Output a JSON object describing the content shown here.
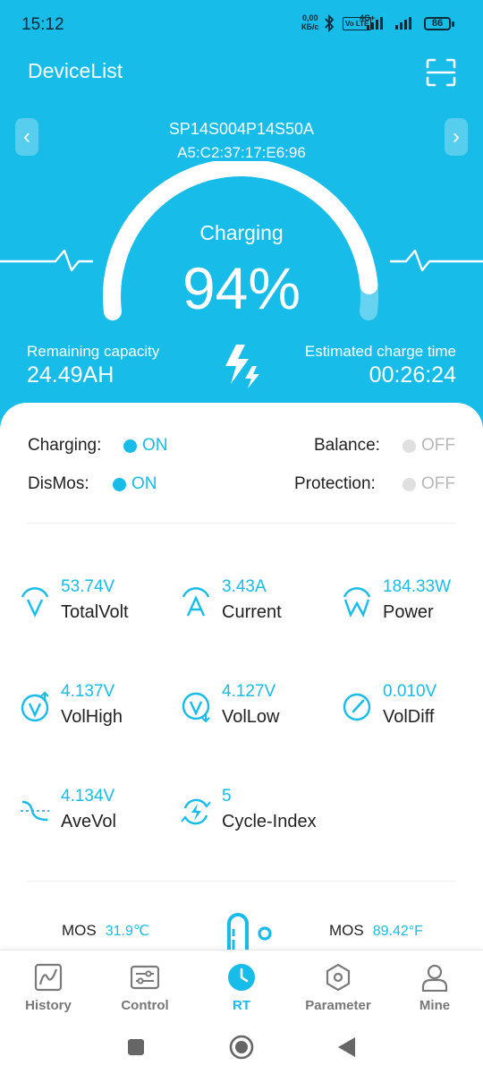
{
  "status_bar": {
    "time": "15:12",
    "net_speed_value": "0,00",
    "net_speed_unit": "КБ/с",
    "volte": "Vo LTE",
    "network": "4G+",
    "battery": "86"
  },
  "header": {
    "title": "DeviceList",
    "scan_icon": "scan-icon"
  },
  "device": {
    "name": "SP14S004P14S50A",
    "mac": "A5:C2:37:17:E6:96"
  },
  "gauge": {
    "state": "Charging",
    "percent_label": "94%",
    "percent": 94
  },
  "capacity": {
    "label": "Remaining capacity",
    "value": "24.49AH"
  },
  "charge_time": {
    "label": "Estimated charge time",
    "value": "00:26:24"
  },
  "flags": {
    "charging": {
      "label": "Charging:",
      "value": "ON"
    },
    "balance": {
      "label": "Balance:",
      "value": "OFF"
    },
    "dismos": {
      "label": "DisMos:",
      "value": "ON"
    },
    "protection": {
      "label": "Protection:",
      "value": "OFF"
    }
  },
  "metrics": {
    "total_volt": {
      "value": "53.74V",
      "label": "TotalVolt",
      "icon": "volt-icon"
    },
    "current": {
      "value": "3.43A",
      "label": "Current",
      "icon": "current-icon"
    },
    "power": {
      "value": "184.33W",
      "label": "Power",
      "icon": "power-icon"
    },
    "vol_high": {
      "value": "4.137V",
      "label": "VolHigh",
      "icon": "vol-high-icon"
    },
    "vol_low": {
      "value": "4.127V",
      "label": "VolLow",
      "icon": "vol-low-icon"
    },
    "vol_diff": {
      "value": "0.010V",
      "label": "VolDiff",
      "icon": "gauge-icon"
    },
    "ave_vol": {
      "value": "4.134V",
      "label": "AveVol",
      "icon": "average-icon"
    },
    "cycle_index": {
      "value": "5",
      "label": "Cycle-Index",
      "icon": "cycle-icon"
    }
  },
  "temperature": {
    "left_label": "MOS",
    "left_value": "31.9℃",
    "right_label": "MOS",
    "right_value": "89.42°F"
  },
  "bottom_nav": {
    "active": "RT",
    "tabs": [
      {
        "label": "History",
        "icon": "history-chart-icon"
      },
      {
        "label": "Control",
        "icon": "control-sliders-icon"
      },
      {
        "label": "RT",
        "icon": "realtime-clock-icon"
      },
      {
        "label": "Parameter",
        "icon": "parameter-hexagon-icon"
      },
      {
        "label": "Mine",
        "icon": "user-icon"
      }
    ]
  },
  "colors": {
    "accent": "#18bce8",
    "off": "#e0e0e0",
    "text": "#222222"
  }
}
